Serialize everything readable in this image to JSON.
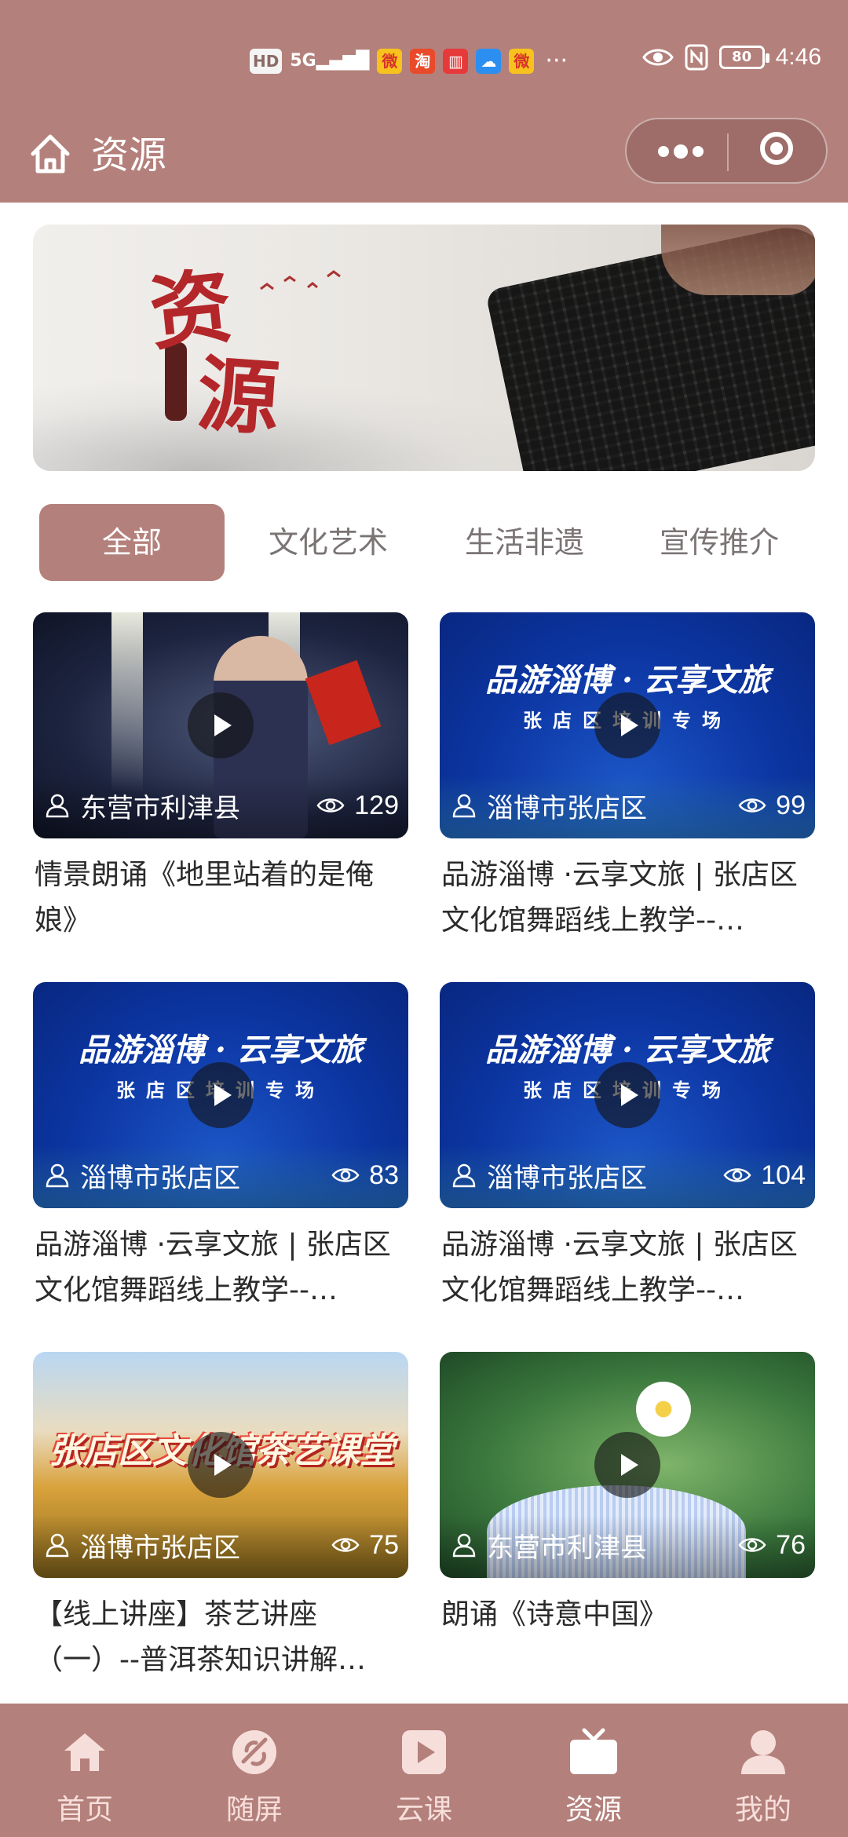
{
  "status_bar": {
    "hd": "HD",
    "signal": "5G",
    "battery": "80",
    "time": "4:46",
    "more": "···",
    "app_icons": [
      "weibo-icon",
      "taobao-icon",
      "book-icon",
      "cloud-icon",
      "weibo-icon"
    ]
  },
  "header": {
    "title": "资源"
  },
  "tabs": [
    {
      "label": "全部",
      "active": true
    },
    {
      "label": "文化艺术",
      "active": false
    },
    {
      "label": "生活非遗",
      "active": false
    },
    {
      "label": "宣传推介",
      "active": false
    }
  ],
  "cards": [
    {
      "location": "东营市利津县",
      "views": "129",
      "title": "情景朗诵《地里站着的是俺娘》",
      "thumb": "stage"
    },
    {
      "location": "淄博市张店区",
      "views": "99",
      "title": "品游淄博 ·云享文旅 | 张店区文化馆舞蹈线上教学--…",
      "thumb": "blue"
    },
    {
      "location": "淄博市张店区",
      "views": "83",
      "title": "品游淄博 ·云享文旅 | 张店区文化馆舞蹈线上教学--…",
      "thumb": "blue"
    },
    {
      "location": "淄博市张店区",
      "views": "104",
      "title": "品游淄博 ·云享文旅 | 张店区文化馆舞蹈线上教学--…",
      "thumb": "blue"
    },
    {
      "location": "淄博市张店区",
      "views": "75",
      "title": "【线上讲座】茶艺讲座（一）--普洱茶知识讲解…",
      "thumb": "tea"
    },
    {
      "location": "东营市利津县",
      "views": "76",
      "title": "朗诵《诗意中国》",
      "thumb": "green"
    }
  ],
  "thumb_text": {
    "blue_title": "品游淄博 · 云享文旅",
    "blue_subtitle": "张店区培训专场",
    "tea_title": "张店区文化馆茶艺课堂"
  },
  "banner": {
    "char1": "资",
    "char2": "源"
  },
  "bottom_nav": [
    {
      "label": "首页",
      "icon": "home-icon",
      "active": false
    },
    {
      "label": "随屏",
      "icon": "screen-icon",
      "active": false
    },
    {
      "label": "云课",
      "icon": "play-icon",
      "active": false
    },
    {
      "label": "资源",
      "icon": "tv-icon",
      "active": true
    },
    {
      "label": "我的",
      "icon": "user-icon",
      "active": false
    }
  ],
  "colors": {
    "brand": "#b4807b",
    "text": "#2b2b2b",
    "tab_inactive": "#7b7474"
  }
}
